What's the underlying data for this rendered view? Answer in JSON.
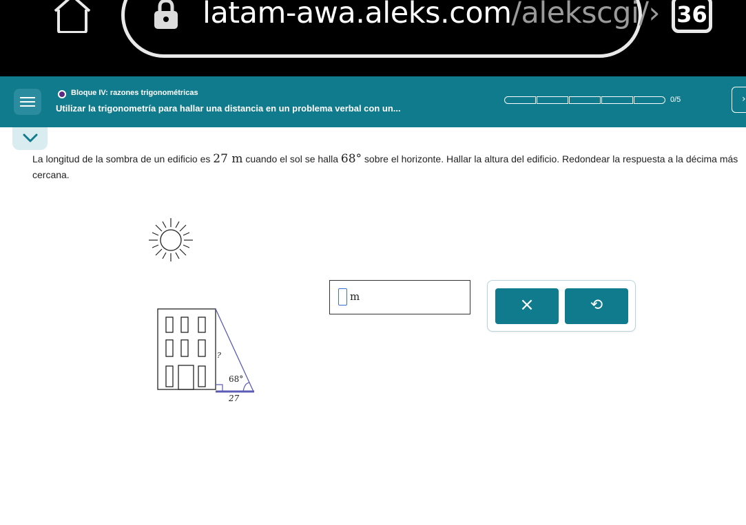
{
  "browser": {
    "url_main": "latam-awa.aleks.com",
    "url_rest": "/alekscgi/›",
    "tab_count": "36",
    "icons": [
      "home-icon",
      "lock-icon"
    ]
  },
  "header": {
    "topic": "Bloque IV: razones trigonométricas",
    "lesson": "Utilizar la trigonometría para hallar una distancia en un problema verbal con un...",
    "progress_text": "0/5",
    "progress_segments": 5,
    "progress_filled": 0,
    "explain_glyph": "›",
    "colors": {
      "header": "#117b8e",
      "topic_dot": "#5a2a86",
      "button": "#117b8e"
    }
  },
  "question": {
    "part1": "La longitud de la sombra de un edificio es ",
    "length_math": "27 m",
    "part2": " cuando el sol se halla ",
    "angle_math": "68°",
    "part3": " sobre el horizonte. Hallar la altura del edificio. Redondear la respuesta a la décima más",
    "part4": "cercana."
  },
  "figure": {
    "unknown_label": "?",
    "angle_label": "68°",
    "base_label": "27",
    "icons": [
      "sun-icon",
      "building-icon",
      "right-angle-icon"
    ]
  },
  "answer": {
    "unit": "m",
    "value": ""
  },
  "actions": {
    "clear_glyph": "×",
    "undo_glyph": "⟲"
  }
}
